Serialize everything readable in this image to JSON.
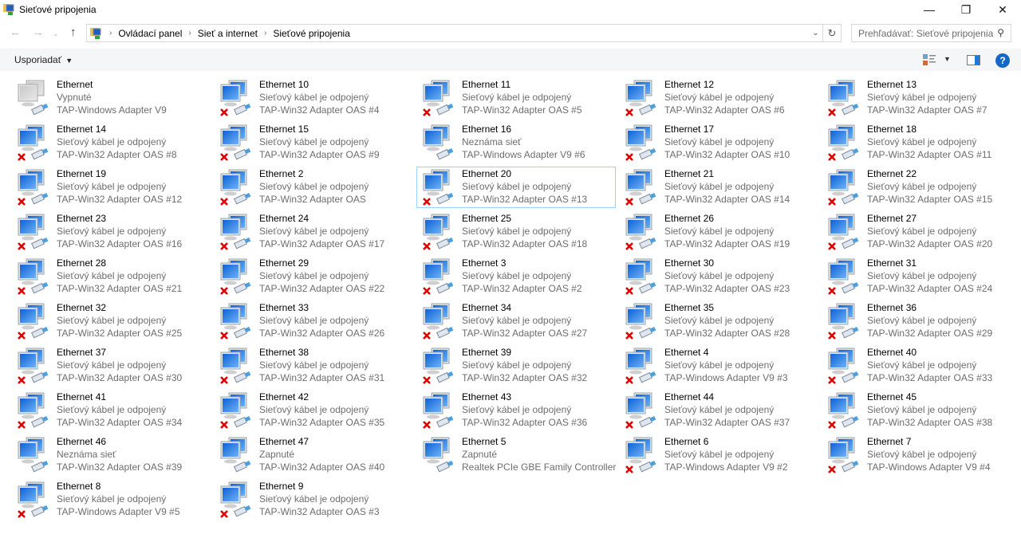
{
  "window": {
    "title": "Sieťové pripojenia",
    "minimize": "—",
    "maximize": "❐",
    "close": "✕"
  },
  "breadcrumb": [
    "Ovládací panel",
    "Sieť a internet",
    "Sieťové pripojenia"
  ],
  "search": {
    "placeholder": "Prehľadávať: Sieťové pripojenia"
  },
  "toolbar": {
    "organize": "Usporiadať",
    "help": "?"
  },
  "colors": {
    "accent": "#1568c8",
    "selection": "#99d1ff",
    "error": "#e00000"
  },
  "items": [
    {
      "name": "Ethernet",
      "status": "Vypnuté",
      "adapter": "TAP-Windows Adapter V9",
      "icon": "disabled"
    },
    {
      "name": "Ethernet 10",
      "status": "Sieťový kábel je odpojený",
      "adapter": "TAP-Win32 Adapter OAS #4",
      "icon": "disconnected"
    },
    {
      "name": "Ethernet 11",
      "status": "Sieťový kábel je odpojený",
      "adapter": "TAP-Win32 Adapter OAS #5",
      "icon": "disconnected"
    },
    {
      "name": "Ethernet 12",
      "status": "Sieťový kábel je odpojený",
      "adapter": "TAP-Win32 Adapter OAS #6",
      "icon": "disconnected"
    },
    {
      "name": "Ethernet 13",
      "status": "Sieťový kábel je odpojený",
      "adapter": "TAP-Win32 Adapter OAS #7",
      "icon": "disconnected"
    },
    {
      "name": "Ethernet 14",
      "status": "Sieťový kábel je odpojený",
      "adapter": "TAP-Win32 Adapter OAS #8",
      "icon": "disconnected"
    },
    {
      "name": "Ethernet 15",
      "status": "Sieťový kábel je odpojený",
      "adapter": "TAP-Win32 Adapter OAS #9",
      "icon": "disconnected"
    },
    {
      "name": "Ethernet 16",
      "status": "Neznáma sieť",
      "adapter": "TAP-Windows Adapter V9 #6",
      "icon": "connected"
    },
    {
      "name": "Ethernet 17",
      "status": "Sieťový kábel je odpojený",
      "adapter": "TAP-Win32 Adapter OAS #10",
      "icon": "disconnected"
    },
    {
      "name": "Ethernet 18",
      "status": "Sieťový kábel je odpojený",
      "adapter": "TAP-Win32 Adapter OAS #11",
      "icon": "disconnected"
    },
    {
      "name": "Ethernet 19",
      "status": "Sieťový kábel je odpojený",
      "adapter": "TAP-Win32 Adapter OAS #12",
      "icon": "disconnected"
    },
    {
      "name": "Ethernet 2",
      "status": "Sieťový kábel je odpojený",
      "adapter": "TAP-Win32 Adapter OAS",
      "icon": "disconnected"
    },
    {
      "name": "Ethernet 20",
      "status": "Sieťový kábel je odpojený",
      "adapter": "TAP-Win32 Adapter OAS #13",
      "icon": "disconnected",
      "selected": true
    },
    {
      "name": "Ethernet 21",
      "status": "Sieťový kábel je odpojený",
      "adapter": "TAP-Win32 Adapter OAS #14",
      "icon": "disconnected"
    },
    {
      "name": "Ethernet 22",
      "status": "Sieťový kábel je odpojený",
      "adapter": "TAP-Win32 Adapter OAS #15",
      "icon": "disconnected"
    },
    {
      "name": "Ethernet 23",
      "status": "Sieťový kábel je odpojený",
      "adapter": "TAP-Win32 Adapter OAS #16",
      "icon": "disconnected"
    },
    {
      "name": "Ethernet 24",
      "status": "Sieťový kábel je odpojený",
      "adapter": "TAP-Win32 Adapter OAS #17",
      "icon": "disconnected"
    },
    {
      "name": "Ethernet 25",
      "status": "Sieťový kábel je odpojený",
      "adapter": "TAP-Win32 Adapter OAS #18",
      "icon": "disconnected"
    },
    {
      "name": "Ethernet 26",
      "status": "Sieťový kábel je odpojený",
      "adapter": "TAP-Win32 Adapter OAS #19",
      "icon": "disconnected"
    },
    {
      "name": "Ethernet 27",
      "status": "Sieťový kábel je odpojený",
      "adapter": "TAP-Win32 Adapter OAS #20",
      "icon": "disconnected"
    },
    {
      "name": "Ethernet 28",
      "status": "Sieťový kábel je odpojený",
      "adapter": "TAP-Win32 Adapter OAS #21",
      "icon": "disconnected"
    },
    {
      "name": "Ethernet 29",
      "status": "Sieťový kábel je odpojený",
      "adapter": "TAP-Win32 Adapter OAS #22",
      "icon": "disconnected"
    },
    {
      "name": "Ethernet 3",
      "status": "Sieťový kábel je odpojený",
      "adapter": "TAP-Win32 Adapter OAS #2",
      "icon": "disconnected"
    },
    {
      "name": "Ethernet 30",
      "status": "Sieťový kábel je odpojený",
      "adapter": "TAP-Win32 Adapter OAS #23",
      "icon": "disconnected"
    },
    {
      "name": "Ethernet 31",
      "status": "Sieťový kábel je odpojený",
      "adapter": "TAP-Win32 Adapter OAS #24",
      "icon": "disconnected"
    },
    {
      "name": "Ethernet 32",
      "status": "Sieťový kábel je odpojený",
      "adapter": "TAP-Win32 Adapter OAS #25",
      "icon": "disconnected"
    },
    {
      "name": "Ethernet 33",
      "status": "Sieťový kábel je odpojený",
      "adapter": "TAP-Win32 Adapter OAS #26",
      "icon": "disconnected"
    },
    {
      "name": "Ethernet 34",
      "status": "Sieťový kábel je odpojený",
      "adapter": "TAP-Win32 Adapter OAS #27",
      "icon": "disconnected"
    },
    {
      "name": "Ethernet 35",
      "status": "Sieťový kábel je odpojený",
      "adapter": "TAP-Win32 Adapter OAS #28",
      "icon": "disconnected"
    },
    {
      "name": "Ethernet 36",
      "status": "Sieťový kábel je odpojený",
      "adapter": "TAP-Win32 Adapter OAS #29",
      "icon": "disconnected"
    },
    {
      "name": "Ethernet 37",
      "status": "Sieťový kábel je odpojený",
      "adapter": "TAP-Win32 Adapter OAS #30",
      "icon": "disconnected"
    },
    {
      "name": "Ethernet 38",
      "status": "Sieťový kábel je odpojený",
      "adapter": "TAP-Win32 Adapter OAS #31",
      "icon": "disconnected"
    },
    {
      "name": "Ethernet 39",
      "status": "Sieťový kábel je odpojený",
      "adapter": "TAP-Win32 Adapter OAS #32",
      "icon": "disconnected"
    },
    {
      "name": "Ethernet 4",
      "status": "Sieťový kábel je odpojený",
      "adapter": "TAP-Windows Adapter V9 #3",
      "icon": "disconnected"
    },
    {
      "name": "Ethernet 40",
      "status": "Sieťový kábel je odpojený",
      "adapter": "TAP-Win32 Adapter OAS #33",
      "icon": "disconnected"
    },
    {
      "name": "Ethernet 41",
      "status": "Sieťový kábel je odpojený",
      "adapter": "TAP-Win32 Adapter OAS #34",
      "icon": "disconnected"
    },
    {
      "name": "Ethernet 42",
      "status": "Sieťový kábel je odpojený",
      "adapter": "TAP-Win32 Adapter OAS #35",
      "icon": "disconnected"
    },
    {
      "name": "Ethernet 43",
      "status": "Sieťový kábel je odpojený",
      "adapter": "TAP-Win32 Adapter OAS #36",
      "icon": "disconnected"
    },
    {
      "name": "Ethernet 44",
      "status": "Sieťový kábel je odpojený",
      "adapter": "TAP-Win32 Adapter OAS #37",
      "icon": "disconnected"
    },
    {
      "name": "Ethernet 45",
      "status": "Sieťový kábel je odpojený",
      "adapter": "TAP-Win32 Adapter OAS #38",
      "icon": "disconnected"
    },
    {
      "name": "Ethernet 46",
      "status": "Neznáma sieť",
      "adapter": "TAP-Win32 Adapter OAS #39",
      "icon": "connected"
    },
    {
      "name": "Ethernet 47",
      "status": "Zapnuté",
      "adapter": "TAP-Win32 Adapter OAS #40",
      "icon": "connected"
    },
    {
      "name": "Ethernet 5",
      "status": "Zapnuté",
      "adapter": "Realtek PCIe GBE Family Controller",
      "icon": "connected"
    },
    {
      "name": "Ethernet 6",
      "status": "Sieťový kábel je odpojený",
      "adapter": "TAP-Windows Adapter V9 #2",
      "icon": "disconnected"
    },
    {
      "name": "Ethernet 7",
      "status": "Sieťový kábel je odpojený",
      "adapter": "TAP-Windows Adapter V9 #4",
      "icon": "disconnected"
    },
    {
      "name": "Ethernet 8",
      "status": "Sieťový kábel je odpojený",
      "adapter": "TAP-Windows Adapter V9 #5",
      "icon": "disconnected"
    },
    {
      "name": "Ethernet 9",
      "status": "Sieťový kábel je odpojený",
      "adapter": "TAP-Win32 Adapter OAS #3",
      "icon": "disconnected"
    }
  ]
}
